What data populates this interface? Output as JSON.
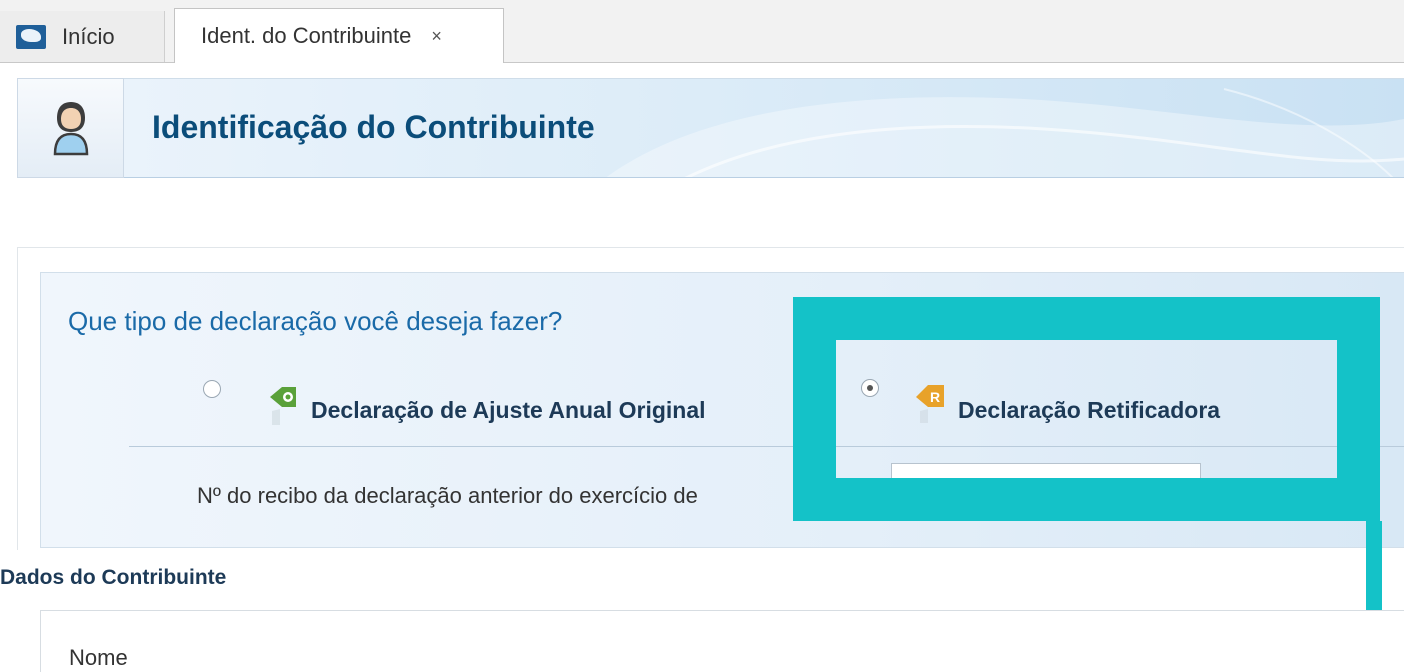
{
  "tabs": {
    "home_label": "Início",
    "ident_label": "Ident. do Contribuinte",
    "close_glyph": "×"
  },
  "header": {
    "title": "Identificação do Contribuinte"
  },
  "question": {
    "title": "Que tipo de declaração você deseja fazer?",
    "options": [
      {
        "label": "Declaração de Ajuste Anual Original",
        "selected": false,
        "icon": "tag-o-icon"
      },
      {
        "label": "Declaração Retificadora",
        "selected": true,
        "icon": "tag-r-icon"
      }
    ],
    "receipt_label": "Nº do recibo da declaração anterior do exercício de",
    "receipt_value": ""
  },
  "contribuinte": {
    "section_title": "Dados do Contribuinte",
    "nome_label": "Nome"
  },
  "colors": {
    "accent": "#1a6aa8",
    "title": "#0b4d7a",
    "highlight": "#14c2c8"
  }
}
